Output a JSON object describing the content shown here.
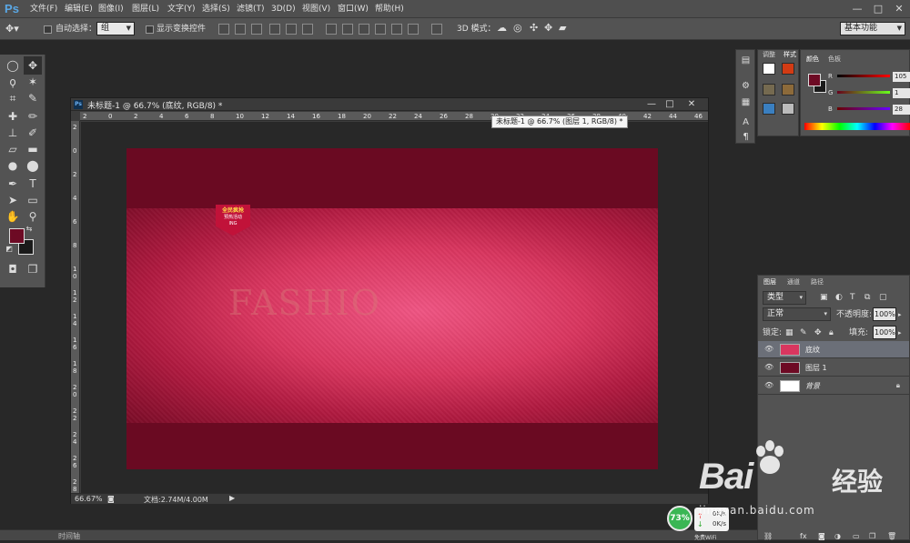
{
  "app": {
    "logo": "Ps"
  },
  "menu": [
    "文件(F)",
    "编辑(E)",
    "图像(I)",
    "图层(L)",
    "文字(Y)",
    "选择(S)",
    "滤镜(T)",
    "3D(D)",
    "视图(V)",
    "窗口(W)",
    "帮助(H)"
  ],
  "window_controls": {
    "minimize": "—",
    "maximize": "□",
    "close": "✕"
  },
  "options": {
    "auto_select_label": "自动选择：",
    "auto_select_value": "组",
    "show_transform_label": "显示变换控件",
    "mode_3d_label": "3D 模式：",
    "workspace": "基本功能"
  },
  "document": {
    "title": "未标题-1 @ 66.7% (底纹, RGB/8) *",
    "tooltip": "未标题-1 @ 66.7% (图层 1, RGB/8) *",
    "zoom": "66.67%",
    "doc_size": "文档:2.74M/4.00M",
    "ruler_h": [
      "2",
      "0",
      "2",
      "4",
      "6",
      "8",
      "10",
      "12",
      "14",
      "16",
      "18",
      "20",
      "22",
      "24",
      "26",
      "28",
      "30",
      "32",
      "34",
      "36",
      "38",
      "40",
      "42",
      "44",
      "46"
    ],
    "ruler_v": [
      "2",
      "0",
      "2",
      "4",
      "6",
      "8",
      "1 0",
      "1 2",
      "1 4",
      "1 6",
      "1 8",
      "2 0",
      "2 2",
      "2 4",
      "2 6",
      "2 8"
    ]
  },
  "canvas": {
    "fashion_text": "FASHIO",
    "badge": {
      "line1": "全民疯抢",
      "line2": "预热活动",
      "line3": "ING"
    },
    "colors": {
      "dark": "#6a0a22",
      "light": "#ef5583"
    }
  },
  "panels": {
    "adjust_tabs": [
      "调整",
      "样式"
    ],
    "color_tabs": [
      "颜色",
      "色板"
    ],
    "rgb": {
      "r_label": "R",
      "r": "105",
      "g_label": "G",
      "g": "1",
      "b_label": "B",
      "b": "28"
    },
    "layers_tabs": [
      "图层",
      "通道",
      "路径"
    ],
    "filter_kind": "类型",
    "blend_mode": "正常",
    "opacity_label": "不透明度:",
    "opacity": "100%",
    "lock_label": "锁定:",
    "fill_label": "填充:",
    "fill": "100%",
    "layers": [
      {
        "name": "底纹",
        "active": true,
        "thumb": "#d9365f"
      },
      {
        "name": "图层 1",
        "active": false,
        "thumb": "#6d0a24"
      },
      {
        "name": "背景",
        "active": false,
        "thumb": "#ffffff",
        "locked": true
      }
    ]
  },
  "timeline": {
    "label": "时间轴"
  },
  "network": {
    "percent": "73%",
    "up": "0K/s",
    "down": "0K/s",
    "wifi": "免费WiFi"
  },
  "watermark": {
    "brand": "Bai",
    "cn": "经验",
    "url": "jingyan.baidu.com"
  }
}
